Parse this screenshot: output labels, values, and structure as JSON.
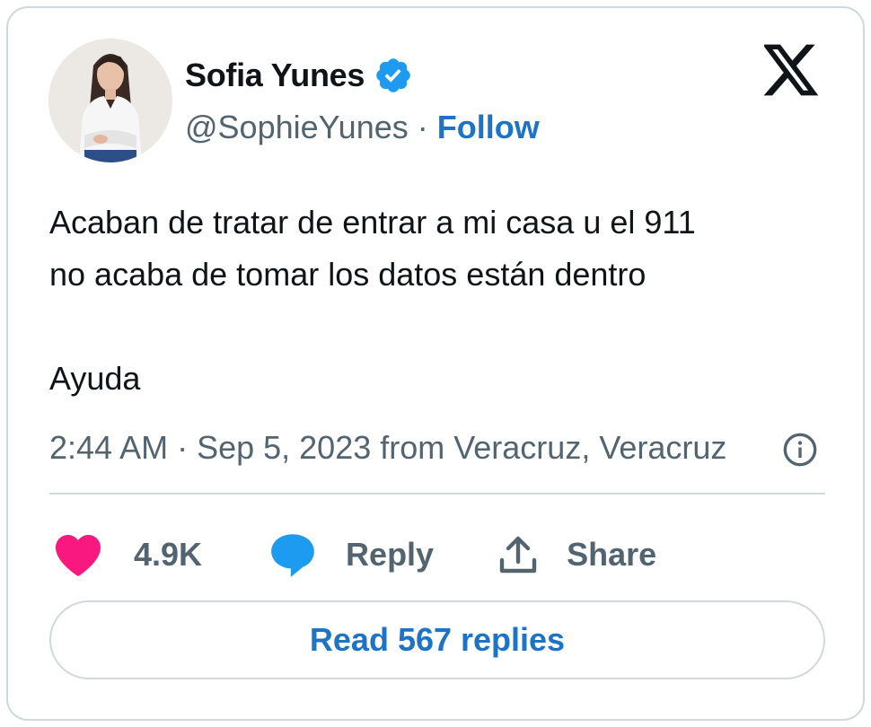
{
  "author": {
    "name": "Sofia Yunes",
    "handle": "@SophieYunes",
    "separator": "·",
    "follow_label": "Follow",
    "verified": true
  },
  "tweet": {
    "lines": [
      "Acaban de tratar de entrar a mi casa u el 911",
      "no acaba de tomar los datos están dentro",
      "Ayuda"
    ],
    "meta": "2:44 AM · Sep 5, 2023 from Veracruz, Veracruz"
  },
  "actions": {
    "likes": "4.9K",
    "reply_label": "Reply",
    "share_label": "Share"
  },
  "read_replies_label": "Read 567 replies",
  "icons": {
    "brand": "x-logo-icon",
    "verified": "verified-badge-icon",
    "info": "info-icon",
    "like": "heart-icon",
    "reply": "speech-bubble-icon",
    "share": "share-upload-icon"
  },
  "colors": {
    "link_blue": "#1d74c7",
    "verified_blue": "#1d9bf0",
    "heart_pink": "#f91880",
    "muted_gray": "#536471",
    "border": "#cfd9de"
  }
}
